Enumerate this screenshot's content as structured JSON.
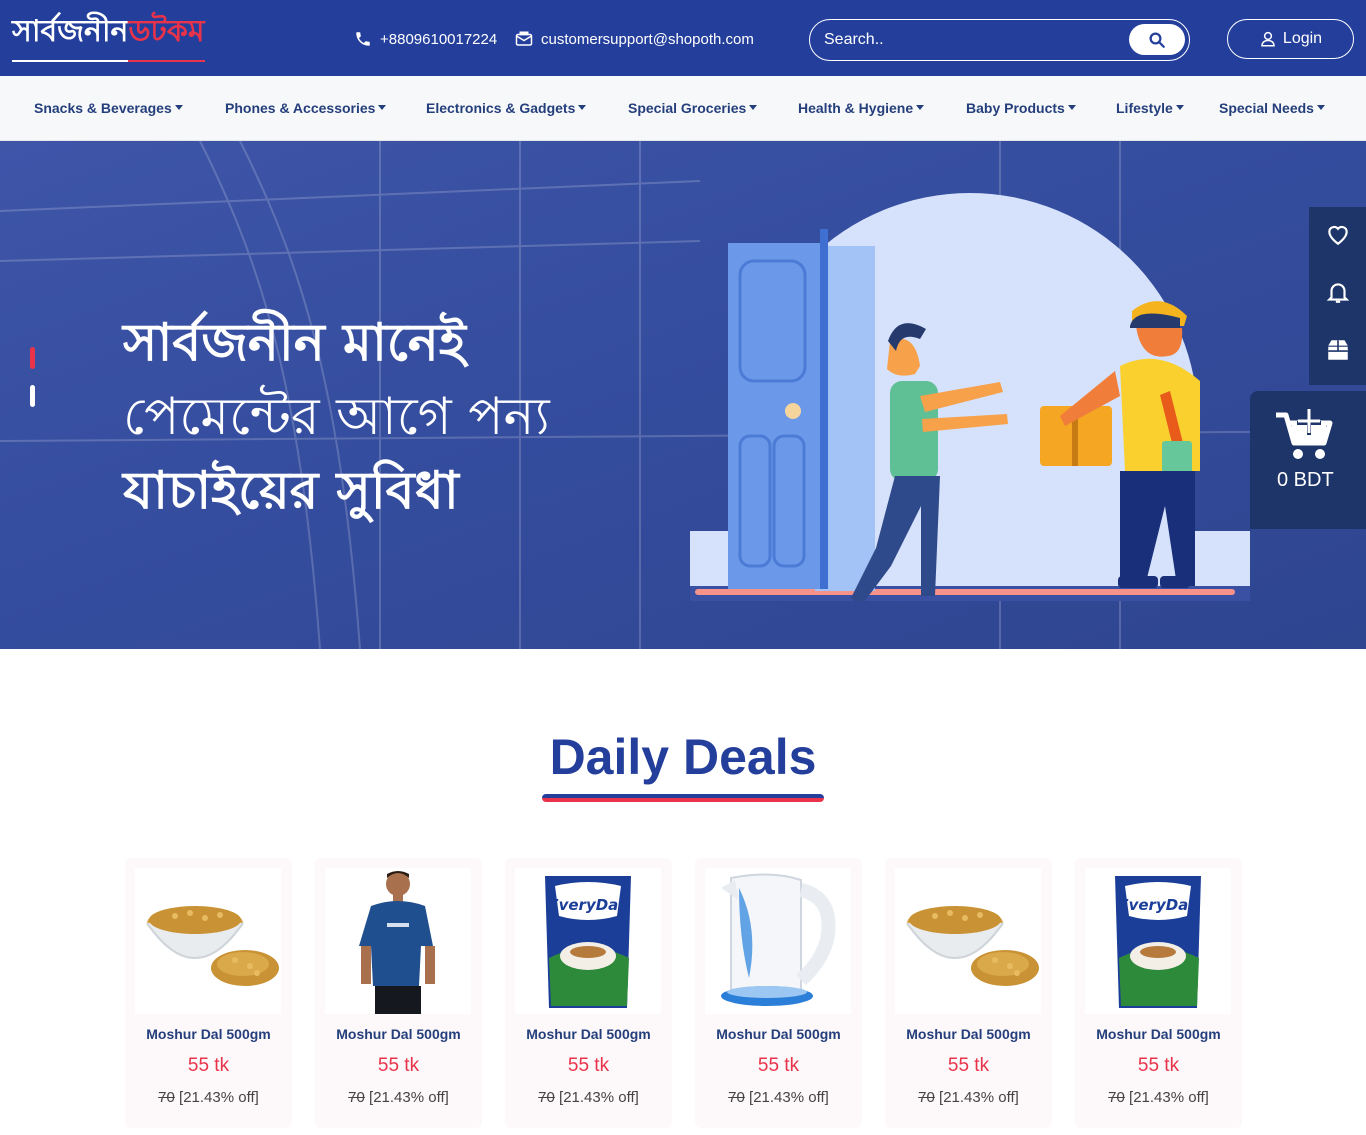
{
  "header": {
    "logo_white": "সার্বজনীন",
    "logo_red": "ডটকম",
    "phone": "+8809610017224",
    "email": "customersupport@shopoth.com",
    "search_placeholder": "Search..",
    "login_label": "Login"
  },
  "nav": {
    "items": [
      {
        "label": "Snacks & Beverages"
      },
      {
        "label": "Phones & Accessories"
      },
      {
        "label": "Electronics & Gadgets"
      },
      {
        "label": "Special Groceries"
      },
      {
        "label": "Health & Hygiene"
      },
      {
        "label": "Baby Products"
      },
      {
        "label": "Lifestyle"
      },
      {
        "label": "Special Needs"
      }
    ]
  },
  "hero": {
    "line1": "সার্বজনীন মানেই",
    "line2": "পেমেন্টের আগে পন্য",
    "line3": "যাচাইয়ের সুবিধা"
  },
  "cart": {
    "amount": "0 BDT"
  },
  "deals": {
    "title": "Daily Deals",
    "products": [
      {
        "name": "Moshur Dal 500gm",
        "price": "55 tk",
        "old_price": "70",
        "discount": "[21.43% off]",
        "image": "lentils"
      },
      {
        "name": "Moshur Dal 500gm",
        "price": "55 tk",
        "old_price": "70",
        "discount": "[21.43% off]",
        "image": "tshirt-man"
      },
      {
        "name": "Moshur Dal 500gm",
        "price": "55 tk",
        "old_price": "70",
        "discount": "[21.43% off]",
        "image": "milk-pack"
      },
      {
        "name": "Moshur Dal 500gm",
        "price": "55 tk",
        "old_price": "70",
        "discount": "[21.43% off]",
        "image": "kettle"
      },
      {
        "name": "Moshur Dal 500gm",
        "price": "55 tk",
        "old_price": "70",
        "discount": "[21.43% off]",
        "image": "lentils"
      },
      {
        "name": "Moshur Dal 500gm",
        "price": "55 tk",
        "old_price": "70",
        "discount": "[21.43% off]",
        "image": "milk-pack"
      }
    ]
  },
  "colors": {
    "brand_blue": "#243f9b",
    "accent_red": "#e8334a",
    "panel_dark": "#1d3568"
  }
}
